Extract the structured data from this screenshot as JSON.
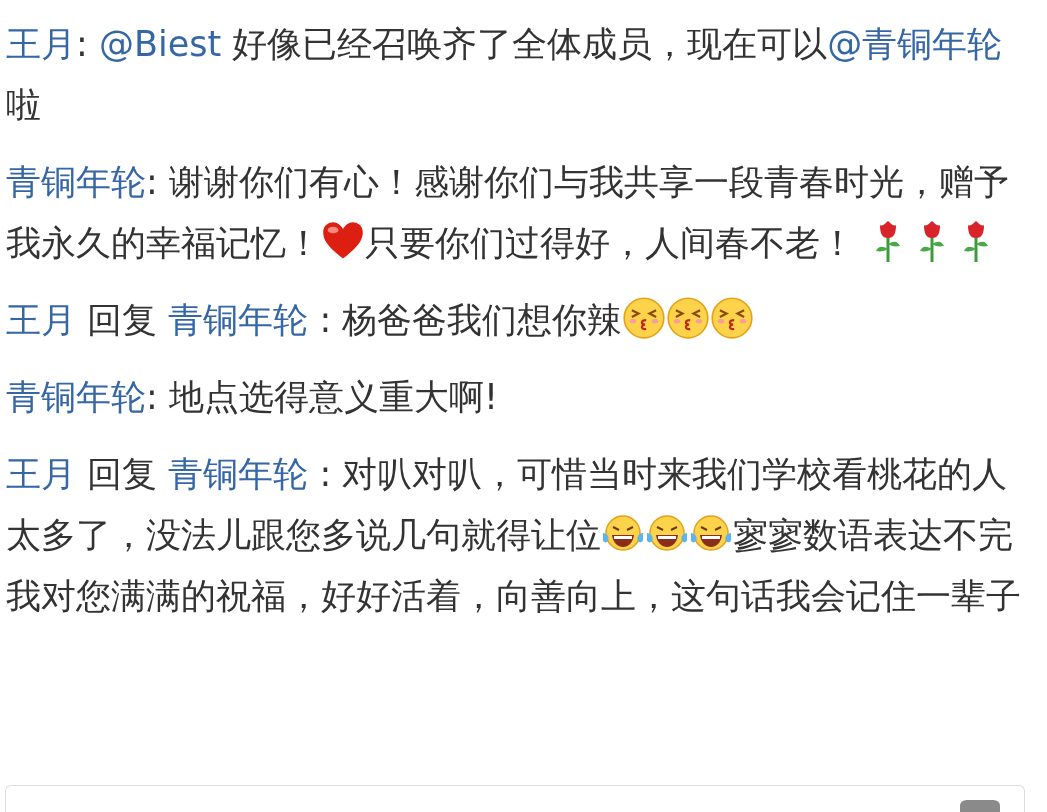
{
  "comments": [
    {
      "parts": [
        {
          "kind": "user",
          "text": "王月"
        },
        {
          "kind": "text",
          "text": ": "
        },
        {
          "kind": "mention",
          "text": "@Biest"
        },
        {
          "kind": "text",
          "text": " 好像已经召唤齐了全体成员，现在可以"
        },
        {
          "kind": "mention",
          "text": "@青铜年轮"
        },
        {
          "kind": "text",
          "text": " 啦"
        }
      ]
    },
    {
      "parts": [
        {
          "kind": "user",
          "text": "青铜年轮"
        },
        {
          "kind": "text",
          "text": ": 谢谢你们有心！感谢你们与我共享一段青春时光，赠予我永久的幸福记忆！"
        },
        {
          "kind": "heart"
        },
        {
          "kind": "text",
          "text": "只要你们过得好，人间春不老！ "
        },
        {
          "kind": "rose"
        },
        {
          "kind": "rose"
        },
        {
          "kind": "rose"
        }
      ]
    },
    {
      "parts": [
        {
          "kind": "user",
          "text": "王月"
        },
        {
          "kind": "text",
          "text": " 回复 "
        },
        {
          "kind": "user",
          "text": "青铜年轮"
        },
        {
          "kind": "text",
          "text": " : 杨爸爸我们想你辣"
        },
        {
          "kind": "kiss"
        },
        {
          "kind": "kiss"
        },
        {
          "kind": "kiss"
        }
      ]
    },
    {
      "parts": [
        {
          "kind": "user",
          "text": "青铜年轮"
        },
        {
          "kind": "text",
          "text": ": 地点选得意义重大啊!"
        }
      ]
    },
    {
      "parts": [
        {
          "kind": "user",
          "text": "王月"
        },
        {
          "kind": "text",
          "text": " 回复 "
        },
        {
          "kind": "user",
          "text": "青铜年轮"
        },
        {
          "kind": "text",
          "text": " : 对叭对叭，可惜当时来我们学校看桃花的人太多了，没法儿跟您多说几句就得让位"
        },
        {
          "kind": "laugh"
        },
        {
          "kind": "laugh"
        },
        {
          "kind": "laugh"
        },
        {
          "kind": "text",
          "text": "寥寥数语表达不完我对您满满的祝福，好好活着，向善向上，这句话我会记住一辈子"
        }
      ]
    }
  ],
  "reply_field": {
    "kind": "input"
  }
}
